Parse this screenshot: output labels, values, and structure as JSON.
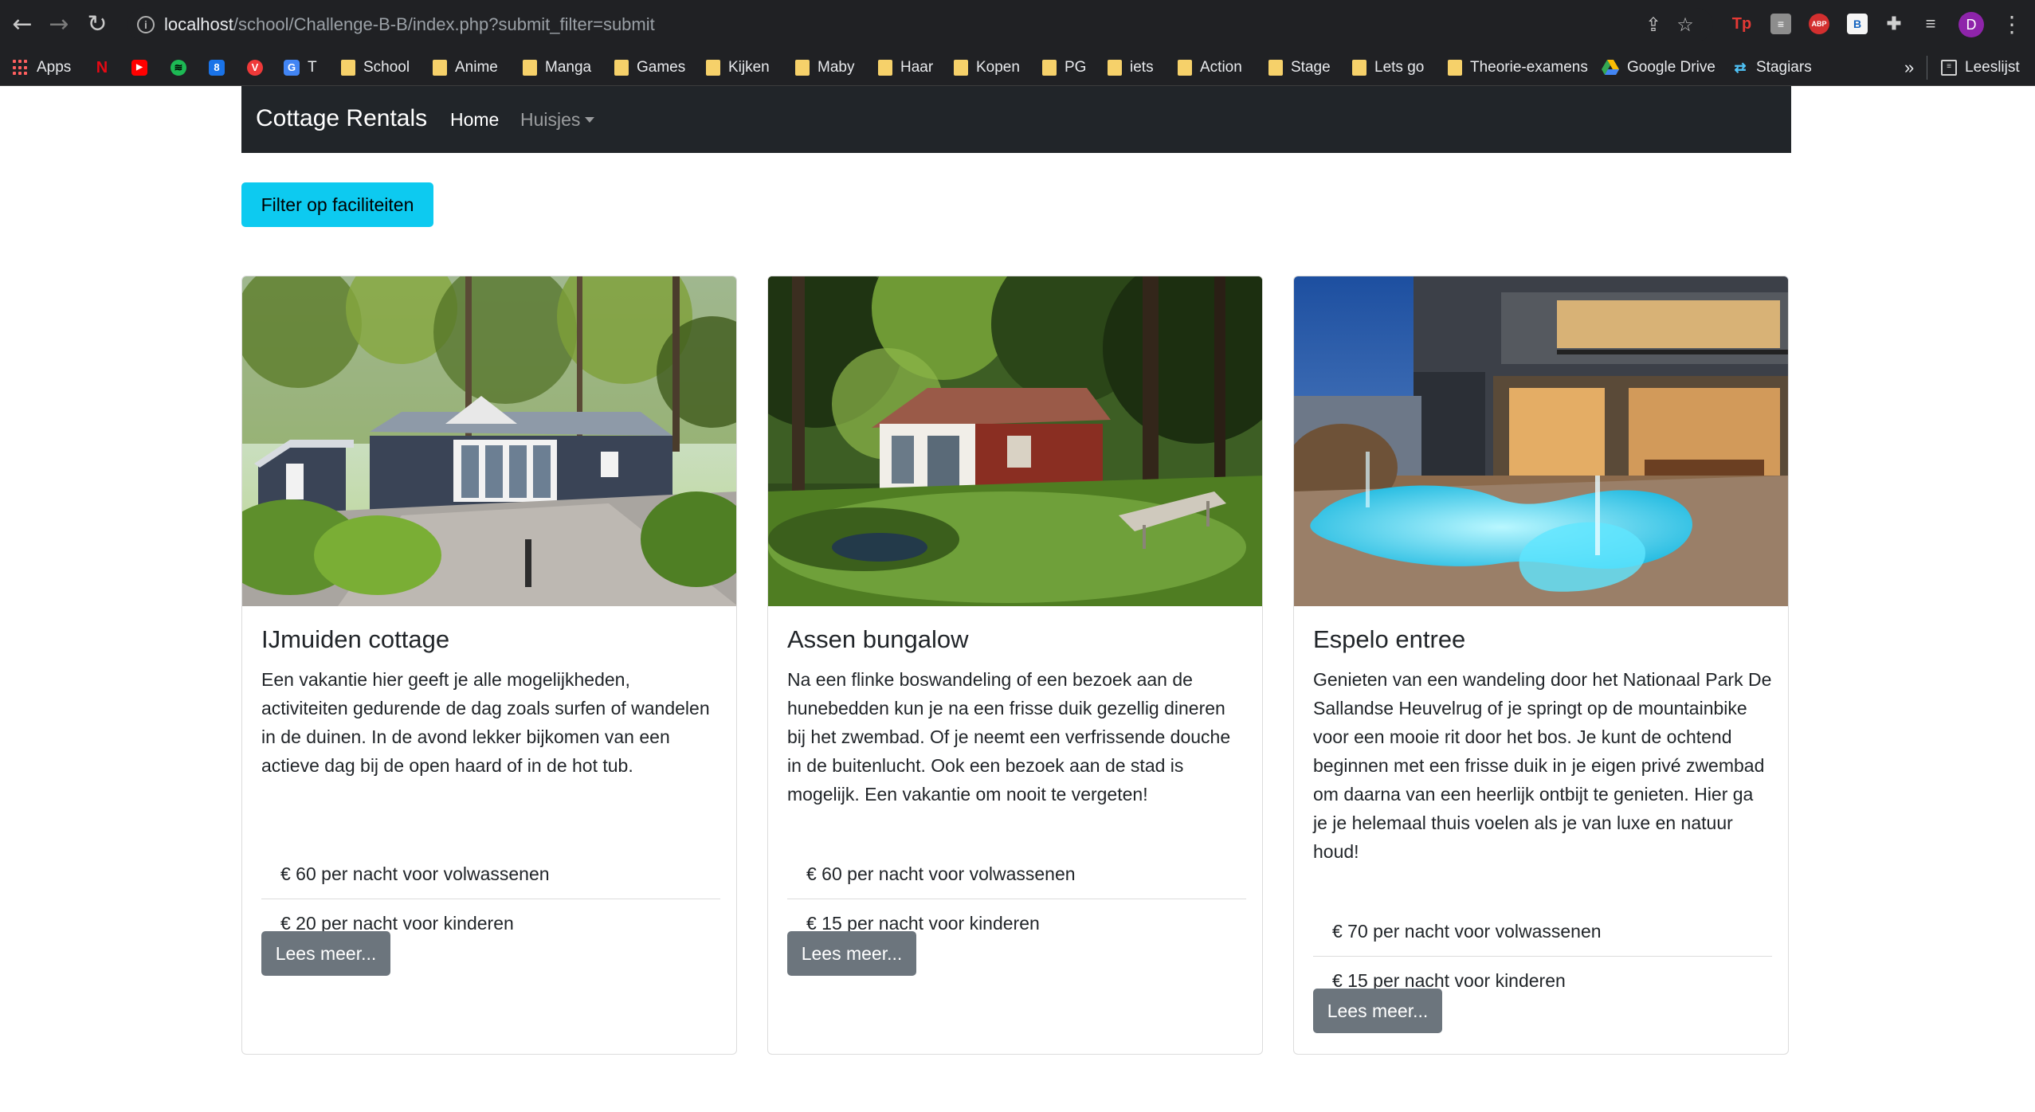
{
  "browser": {
    "url_host": "localhost",
    "url_path": "/school/Challenge-B-B/index.php?submit_filter=submit",
    "profile_initial": "D",
    "extensions": [
      {
        "name": "Tp",
        "color": "#e53935",
        "text": "Tp"
      },
      {
        "name": "notes",
        "color": "#9e9e9e",
        "text": "≡"
      },
      {
        "name": "ABP",
        "color": "#d32f2f",
        "text": "ABP"
      },
      {
        "name": "B",
        "color": "#f5f5f5",
        "text": "B"
      }
    ],
    "bookmarks": [
      {
        "label": "Apps",
        "type": "apps"
      },
      {
        "label": "",
        "type": "icon",
        "icon": "netflix-icon",
        "color": "#e50914",
        "glyph": "N"
      },
      {
        "label": "",
        "type": "icon",
        "icon": "youtube-icon",
        "color": "#ff0000",
        "glyph": "▶"
      },
      {
        "label": "",
        "type": "icon",
        "icon": "spotify-icon",
        "color": "#1db954",
        "glyph": "≋"
      },
      {
        "label": "",
        "type": "icon",
        "icon": "calendar-icon",
        "color": "#1a73e8",
        "glyph": "8"
      },
      {
        "label": "",
        "type": "icon",
        "icon": "vivaldi-icon",
        "color": "#ef3939",
        "glyph": "V"
      },
      {
        "label": "T",
        "type": "icon",
        "icon": "translate-icon",
        "color": "#4285f4",
        "glyph": "G"
      },
      {
        "label": "School",
        "type": "folder"
      },
      {
        "label": "Anime",
        "type": "folder"
      },
      {
        "label": "Manga",
        "type": "folder"
      },
      {
        "label": "Games",
        "type": "folder"
      },
      {
        "label": "Kijken",
        "type": "folder"
      },
      {
        "label": "Maby",
        "type": "folder"
      },
      {
        "label": "Haar",
        "type": "folder"
      },
      {
        "label": "Kopen",
        "type": "folder"
      },
      {
        "label": "PG",
        "type": "folder"
      },
      {
        "label": "iets",
        "type": "folder"
      },
      {
        "label": "Action",
        "type": "folder"
      },
      {
        "label": "Stage",
        "type": "folder"
      },
      {
        "label": "Lets go",
        "type": "folder"
      },
      {
        "label": "Theorie-examens",
        "type": "folder"
      },
      {
        "label": "Google Drive",
        "type": "drive"
      },
      {
        "label": "Stagiars",
        "type": "link"
      }
    ],
    "more_bookmarks": "»",
    "reading_list": "Leeslijst"
  },
  "navbar": {
    "brand": "Cottage Rentals",
    "home": "Home",
    "huisjes": "Huisjes"
  },
  "filter_button": "Filter op faciliteiten",
  "cards": [
    {
      "title": "IJmuiden cottage",
      "text": "Een vakantie hier geeft je alle mogelijkheden, activiteiten gedurende de dag zoals surfen of wandelen in de duinen. In de avond lekker bijkomen van een actieve dag bij de open haard of in de hot tub.",
      "price_adult": "€ 60 per nacht voor volwassenen",
      "price_child": "€ 20 per nacht voor kinderen",
      "button": "Lees meer..."
    },
    {
      "title": "Assen bungalow",
      "text": "Na een flinke boswandeling of een bezoek aan de hunebedden kun je na een frisse duik gezellig dineren bij het zwembad. Of je neemt een verfrissende douche in de buitenlucht. Ook een bezoek aan de stad is mogelijk. Een vakantie om nooit te vergeten!",
      "price_adult": "€ 60 per nacht voor volwassenen",
      "price_child": "€ 15 per nacht voor kinderen",
      "button": "Lees meer..."
    },
    {
      "title": "Espelo entree",
      "text": "Genieten van een wandeling door het Nationaal Park De Sallandse Heuvelrug of je springt op de mountainbike voor een mooie rit door het bos. Je kunt de ochtend beginnen met een frisse duik in je eigen privé zwembad om daarna van een heerlijk ontbijt te genieten. Hier ga je je helemaal thuis voelen als je van luxe en natuur houd!",
      "price_adult": "€ 70 per nacht voor volwassenen",
      "price_child": "€ 15 per nacht voor kinderen",
      "button": "Lees meer..."
    }
  ]
}
